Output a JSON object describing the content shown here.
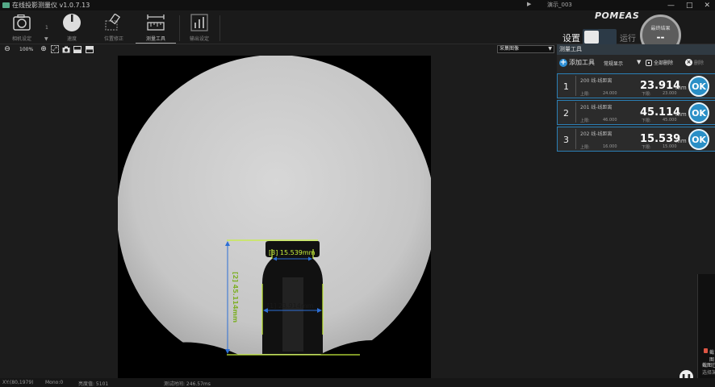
{
  "window": {
    "title": "在线投影测量仪 v1.0.7.13",
    "demo_label": "演示_003",
    "minimize": "—",
    "maximize": "□",
    "close": "✕"
  },
  "toolbar": {
    "camera_label": "相机设定",
    "speed_label": "速度",
    "speed_value": "1",
    "position_label": "位置修正",
    "measure_label": "测量工具",
    "output_label": "输出设定"
  },
  "brand": "POMEAS",
  "mode": {
    "set_label": "设置",
    "run_label": "运行"
  },
  "final_result": {
    "label": "最终结果",
    "value": "--"
  },
  "viewbar": {
    "zoom_value": "100%",
    "capture_option": "采集图像"
  },
  "panel": {
    "title": "测量工具",
    "add_tool": "添加工具",
    "display_mode": "常规显示",
    "delete_all": "全部删除",
    "delete_one": "删除",
    "upper_label": "上限:",
    "lower_label": "下限:",
    "ok_label": "OK",
    "unit": "mm",
    "rows": [
      {
        "index": "1",
        "name": "200 线-线距离",
        "value": "23.914",
        "upper": "24.000",
        "lower": "23.000"
      },
      {
        "index": "2",
        "name": "201 线-线距离",
        "value": "45.114",
        "upper": "46.000",
        "lower": "45.000"
      },
      {
        "index": "3",
        "name": "202 线-线距离",
        "value": "15.539",
        "upper": "16.000",
        "lower": "15.000"
      }
    ]
  },
  "overlay": {
    "label_1": "[1] 23.914mm",
    "label_2": "[2] 45.114mm",
    "label_3": "[3] 15.539mm"
  },
  "status": {
    "xy": "XY:(80,1979)",
    "mono": "Mono:0",
    "exposure": "亮度值: 5101",
    "test_time": "测试时间: 246.57ms"
  },
  "side_window": {
    "line1": "截图",
    "line2": "截图已",
    "line3": "选择某"
  },
  "colors": {
    "accent_blue": "#2a8fc6",
    "measure_green": "#c8f03c",
    "measure_blue": "#2d6fd5"
  }
}
